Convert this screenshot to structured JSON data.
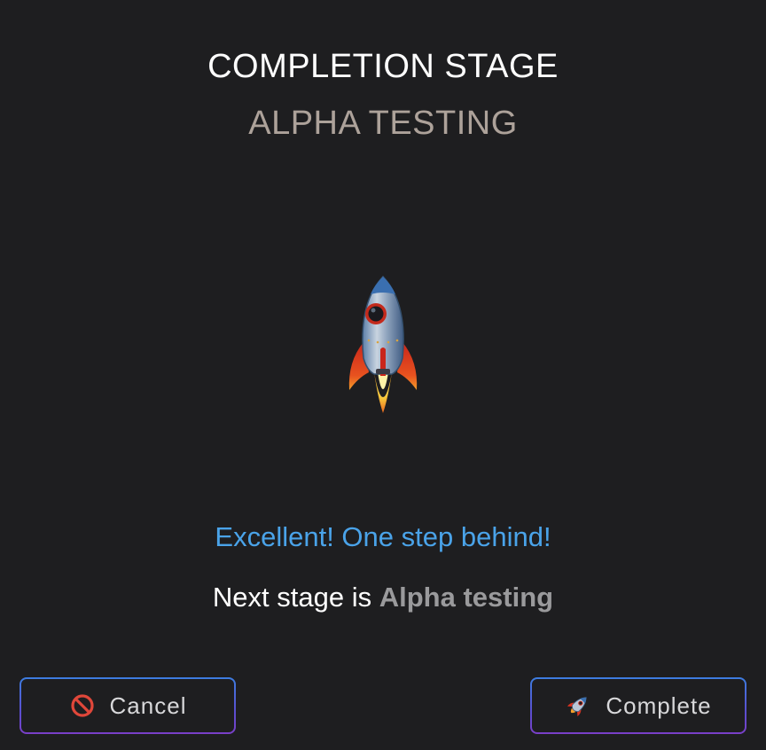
{
  "dialog": {
    "title": "COMPLETION STAGE",
    "subtitle": "ALPHA TESTING",
    "illustration_icon": "rocket-icon",
    "message": "Excellent! One step behind!",
    "next_stage_prefix": "Next stage is ",
    "next_stage_name": "Alpha testing"
  },
  "buttons": {
    "cancel": {
      "label": "Cancel",
      "icon": "prohibited-icon"
    },
    "complete": {
      "label": "Complete",
      "icon": "rocket-icon"
    }
  },
  "colors": {
    "background": "#1e1e20",
    "subtitle": "#ada29a",
    "message": "#4aa3e9",
    "stage_name": "#9a9a9c",
    "button_border_top": "#3d7de0",
    "button_border_bottom": "#7a3fc8"
  }
}
